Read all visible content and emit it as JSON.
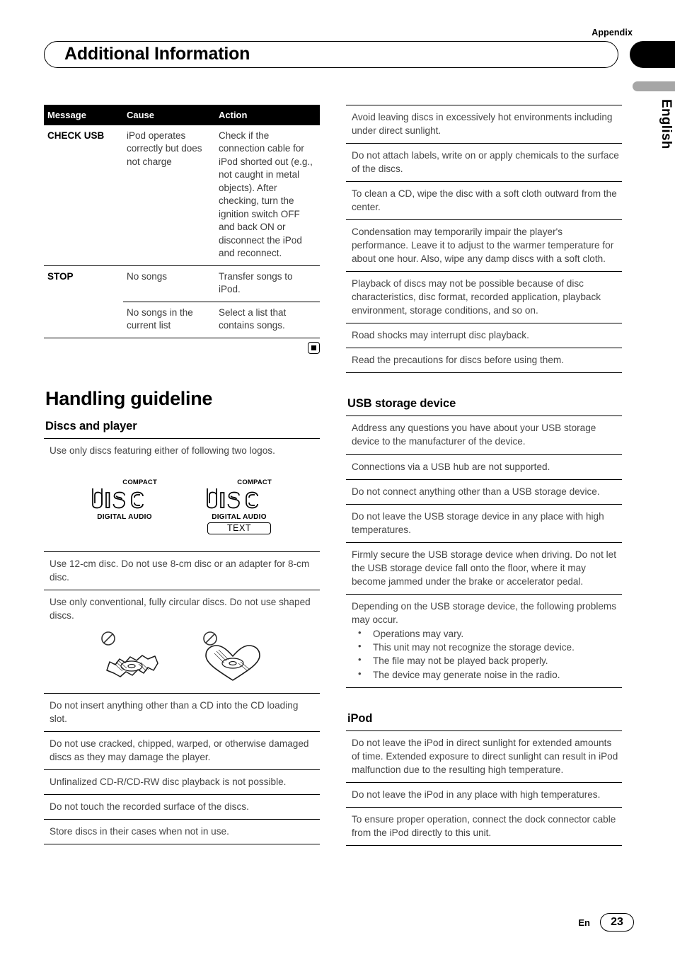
{
  "header": {
    "appendix_label": "Appendix",
    "title": "Additional Information",
    "language_tab": "English"
  },
  "error_table": {
    "columns": [
      "Message",
      "Cause",
      "Action"
    ],
    "rows": [
      {
        "message": "CHECK USB",
        "cause": "iPod operates correctly but does not charge",
        "action": "Check if the connection cable for iPod shorted out (e.g., not caught in metal objects). After checking, turn the ignition switch OFF and back ON or disconnect the iPod and reconnect."
      },
      {
        "message": "STOP",
        "cause": "No songs",
        "action": "Transfer songs to iPod."
      },
      {
        "message": "",
        "cause": "No songs in the current list",
        "action": "Select a list that contains songs."
      }
    ]
  },
  "handling_guideline": {
    "heading": "Handling guideline",
    "discs_and_player": {
      "heading": "Discs and player",
      "intro": "Use only discs featuring either of following two logos.",
      "logos": [
        {
          "compact": "COMPACT",
          "disc": "disc",
          "digital_audio": "DIGITAL AUDIO",
          "text_badge": null
        },
        {
          "compact": "COMPACT",
          "disc": "disc",
          "digital_audio": "DIGITAL AUDIO",
          "text_badge": "TEXT"
        }
      ],
      "items": [
        "Use 12-cm disc. Do not use 8-cm disc or an adapter for 8-cm disc.",
        "Use only conventional, fully circular discs. Do not use shaped discs.",
        "Do not insert anything other than a CD into the CD loading slot.",
        "Do not use cracked, chipped, warped, or otherwise damaged discs as they may damage the player.",
        "Unfinalized CD-R/CD-RW disc playback is not possible.",
        "Do not touch the recorded surface of the discs.",
        "Store discs in their cases when not in use."
      ],
      "right_items": [
        "Avoid leaving discs in excessively hot environments including under direct sunlight.",
        "Do not attach labels, write on or apply chemicals to the surface of the discs.",
        "To clean a CD, wipe the disc with a soft cloth outward from the center.",
        "Condensation may temporarily impair the player's performance. Leave it to adjust to the warmer temperature for about one hour. Also, wipe any damp discs with a soft cloth.",
        "Playback of discs may not be possible because of disc characteristics, disc format, recorded application, playback environment, storage conditions, and so on.",
        "Road shocks may interrupt disc playback.",
        "Read the precautions for discs before using them."
      ]
    },
    "usb_storage_device": {
      "heading": "USB storage device",
      "items": [
        "Address any questions you have about your USB storage device to the manufacturer of the device.",
        "Connections via a USB hub are not supported.",
        "Do not connect anything other than a USB storage device.",
        "Do not leave the USB storage device in any place with high temperatures.",
        "Firmly secure the USB storage device when driving. Do not let the USB storage device fall onto the floor, where it may become jammed under the brake or accelerator pedal."
      ],
      "last_item": {
        "lead": "Depending on the USB storage device, the following problems may occur.",
        "bullets": [
          "Operations may vary.",
          "This unit may not recognize the storage device.",
          "The file may not be played back properly.",
          "The device may generate noise in the radio."
        ]
      }
    },
    "ipod": {
      "heading": "iPod",
      "items": [
        "Do not leave the iPod in direct sunlight for extended amounts of time. Extended exposure to direct sunlight can result in iPod malfunction due to the resulting high temperature.",
        "Do not leave the iPod in any place with high temperatures.",
        "To ensure proper operation, connect the dock connector cable from the iPod directly to this unit."
      ]
    }
  },
  "footer": {
    "language_code": "En",
    "page_number": "23"
  }
}
